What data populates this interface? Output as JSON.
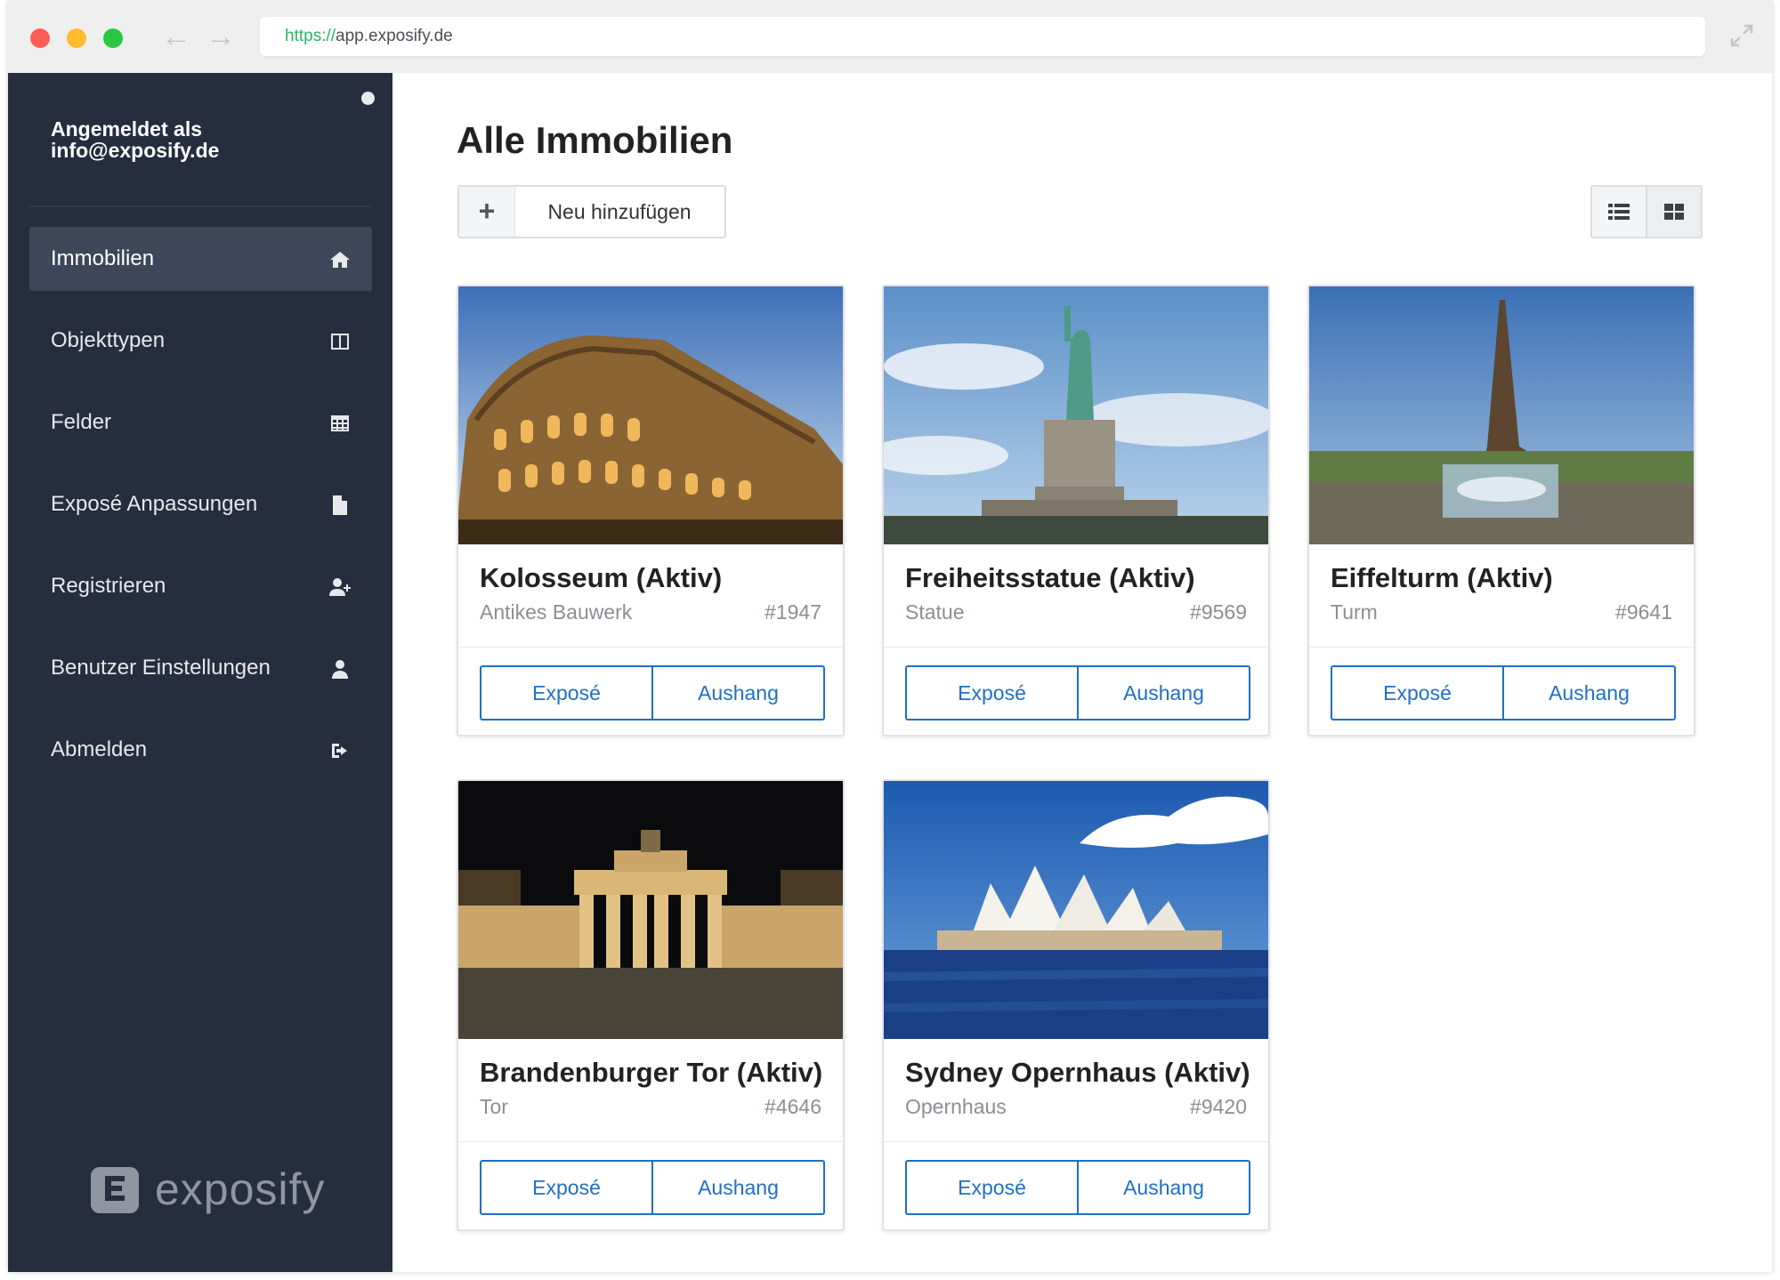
{
  "browser": {
    "url_scheme": "https://",
    "url_host": "app.exposify.de"
  },
  "sidebar": {
    "login_label": "Angemeldet als",
    "login_email": "info@exposify.de",
    "items": [
      {
        "label": "Immobilien",
        "icon": "home-icon",
        "active": true
      },
      {
        "label": "Objekttypen",
        "icon": "columns-icon",
        "active": false
      },
      {
        "label": "Felder",
        "icon": "table-icon",
        "active": false
      },
      {
        "label": "Exposé Anpassungen",
        "icon": "document-icon",
        "active": false
      },
      {
        "label": "Registrieren",
        "icon": "user-plus-icon",
        "active": false
      },
      {
        "label": "Benutzer Einstellungen",
        "icon": "user-icon",
        "active": false
      },
      {
        "label": "Abmelden",
        "icon": "sign-out-icon",
        "active": false
      }
    ],
    "brand": "exposify"
  },
  "main": {
    "title": "Alle Immobilien",
    "add_button": "Neu hinzufügen",
    "cards": [
      {
        "title": "Kolosseum (Aktiv)",
        "subtitle": "Antikes Bauwerk",
        "number": "#1947",
        "image": "colosseum-photo",
        "expose": "Exposé",
        "aushang": "Aushang"
      },
      {
        "title": "Freiheitsstatue (Aktiv)",
        "subtitle": "Statue",
        "number": "#9569",
        "image": "statue-of-liberty-photo",
        "expose": "Exposé",
        "aushang": "Aushang"
      },
      {
        "title": "Eiffelturm (Aktiv)",
        "subtitle": "Turm",
        "number": "#9641",
        "image": "eiffel-tower-photo",
        "expose": "Exposé",
        "aushang": "Aushang"
      },
      {
        "title": "Brandenburger Tor (Aktiv)",
        "subtitle": "Tor",
        "number": "#4646",
        "image": "brandenburg-gate-photo",
        "expose": "Exposé",
        "aushang": "Aushang"
      },
      {
        "title": "Sydney Opernhaus (Aktiv)",
        "subtitle": "Opernhaus",
        "number": "#9420",
        "image": "sydney-opera-house-photo",
        "expose": "Exposé",
        "aushang": "Aushang"
      }
    ]
  },
  "colors": {
    "sidebar_bg": "#252d3f",
    "sidebar_active": "#3e4659",
    "accent_blue": "#1f6fc5",
    "url_scheme_green": "#2bb55f"
  }
}
